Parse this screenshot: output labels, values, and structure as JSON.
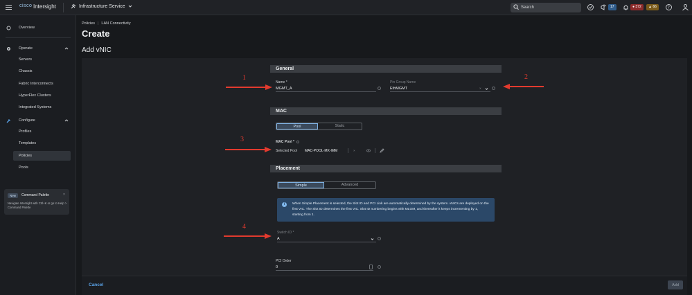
{
  "topbar": {
    "brand_text": "cisco",
    "app_name": "Intersight",
    "service": "Infrastructure Service",
    "search_placeholder": "Search",
    "badge_announcements": "17",
    "badge_critical": "372",
    "badge_warning": "66"
  },
  "sidebar": {
    "overview": "Overview",
    "operate": "Operate",
    "operate_items": [
      "Servers",
      "Chassis",
      "Fabric Interconnects",
      "HyperFlex Clusters",
      "Integrated Systems"
    ],
    "configure": "Configure",
    "configure_items": [
      "Profiles",
      "Templates",
      "Policies",
      "Pools"
    ],
    "palette": {
      "new_label": "New",
      "title": "Command Palette",
      "close": "×",
      "description": "Navigate Intersight with Ctrl+K or go to Help > Command Palette"
    }
  },
  "header": {
    "breadcrumb": [
      "Policies",
      "LAN Connectivity"
    ],
    "page_title": "Create",
    "section_title": "Add vNIC"
  },
  "general": {
    "heading": "General",
    "name_label": "Name *",
    "name_value": "MGMT_A",
    "pin_group_label": "Pin Group Name",
    "pin_group_value": "EthMGMT"
  },
  "mac": {
    "heading": "MAC",
    "options": [
      "Pool",
      "Static"
    ],
    "selected_option": "Pool",
    "pool_label": "MAC Pool *",
    "selected_pool_label": "Selected Pool",
    "selected_pool_value": "MAC-POOL-MX-IMM"
  },
  "placement": {
    "heading": "Placement",
    "options": [
      "Simple",
      "Advanced"
    ],
    "selected_option": "Simple",
    "info": "When Simple Placement is selected, the Slot ID and PCI Link are automatically determined by the system. vNICs are deployed on the first VIC. The Slot ID determines the first VIC. Slot ID numbering begins with MLOM, and thereafter it keeps incrementing by 1, starting from 1.",
    "switch_label": "Switch ID *",
    "switch_value": "A",
    "pci_label": "PCI Order",
    "pci_value": "0"
  },
  "annotations": [
    "1",
    "2",
    "3",
    "4"
  ],
  "footer": {
    "cancel": "Cancel",
    "add": "Add"
  },
  "colors": {
    "accent": "#5aa3e8",
    "annotation_red": "#e23a2e",
    "info_bg": "#2b4868"
  }
}
